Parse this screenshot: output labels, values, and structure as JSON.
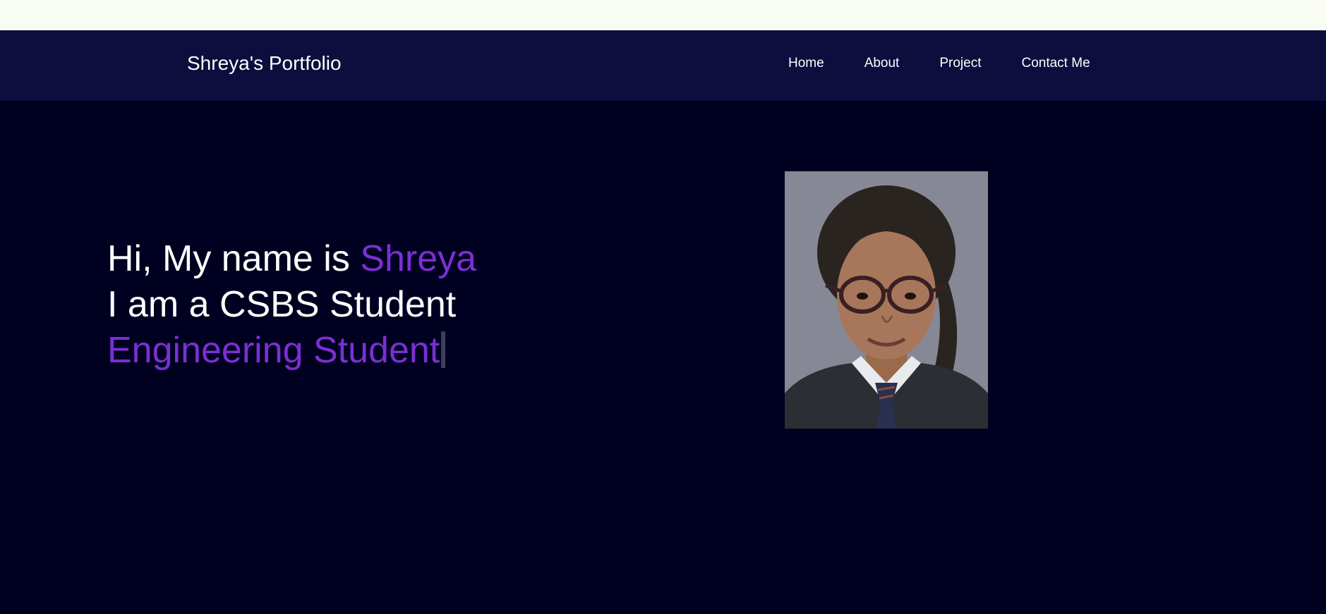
{
  "header": {
    "brand": "Shreya's Portfolio",
    "nav": [
      {
        "label": "Home"
      },
      {
        "label": "About"
      },
      {
        "label": "Project"
      },
      {
        "label": "Contact Me"
      }
    ]
  },
  "hero": {
    "line1_prefix": "Hi, My name is ",
    "line1_name": "Shreya",
    "line2": "I am a CSBS Student",
    "line3_typed": "Engineering Student"
  },
  "colors": {
    "page_bg": "#000020",
    "navbar_bg": "#0d0d3e",
    "accent": "#7b2fd2",
    "top_strip": "#f8fcf2"
  }
}
